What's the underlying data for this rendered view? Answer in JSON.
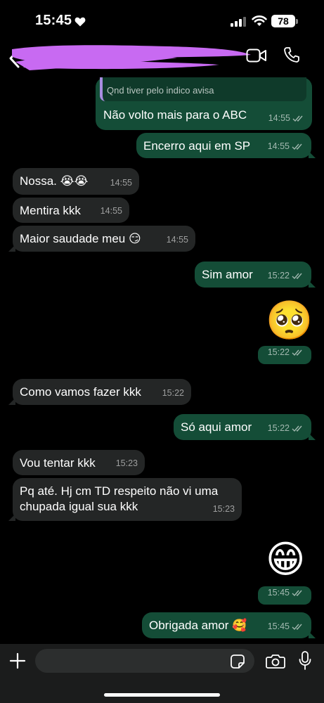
{
  "status_bar": {
    "time": "15:45",
    "battery": "78"
  },
  "header": {
    "contact_name_redacted": true
  },
  "messages": {
    "m1": {
      "quote": "Qnd tiver pelo indico avisa",
      "text": "Não volto mais para o ABC",
      "time": "14:55"
    },
    "m2": {
      "text": "Encerro aqui em SP",
      "time": "14:55"
    },
    "m3": {
      "text": "Nossa. 😭😭",
      "time": "14:55"
    },
    "m4": {
      "text": "Mentira kkk",
      "time": "14:55"
    },
    "m5": {
      "text": "Maior saudade meu 😏",
      "time": "14:55"
    },
    "m6": {
      "text": "Sim amor",
      "time": "15:22"
    },
    "m7": {
      "emoji": "🥺",
      "time": "15:22"
    },
    "m8": {
      "text": "Como vamos fazer kkk",
      "time": "15:22"
    },
    "m9": {
      "text": "Só aqui amor",
      "time": "15:22"
    },
    "m10": {
      "text": "Vou tentar kkk",
      "time": "15:23"
    },
    "m11": {
      "line1": "Pq até. Hj cm TD respeito não vi uma",
      "line2": "chupada igual sua kkk",
      "time": "15:23"
    },
    "m12": {
      "emoji": "😁",
      "time": "15:45"
    },
    "m13": {
      "text": "Obrigada amor 🥰",
      "time": "15:45"
    }
  },
  "input": {
    "placeholder": ""
  },
  "colors": {
    "incoming_bubble": "#242626",
    "outgoing_bubble": "#144d37",
    "redaction": "#c86af2"
  }
}
